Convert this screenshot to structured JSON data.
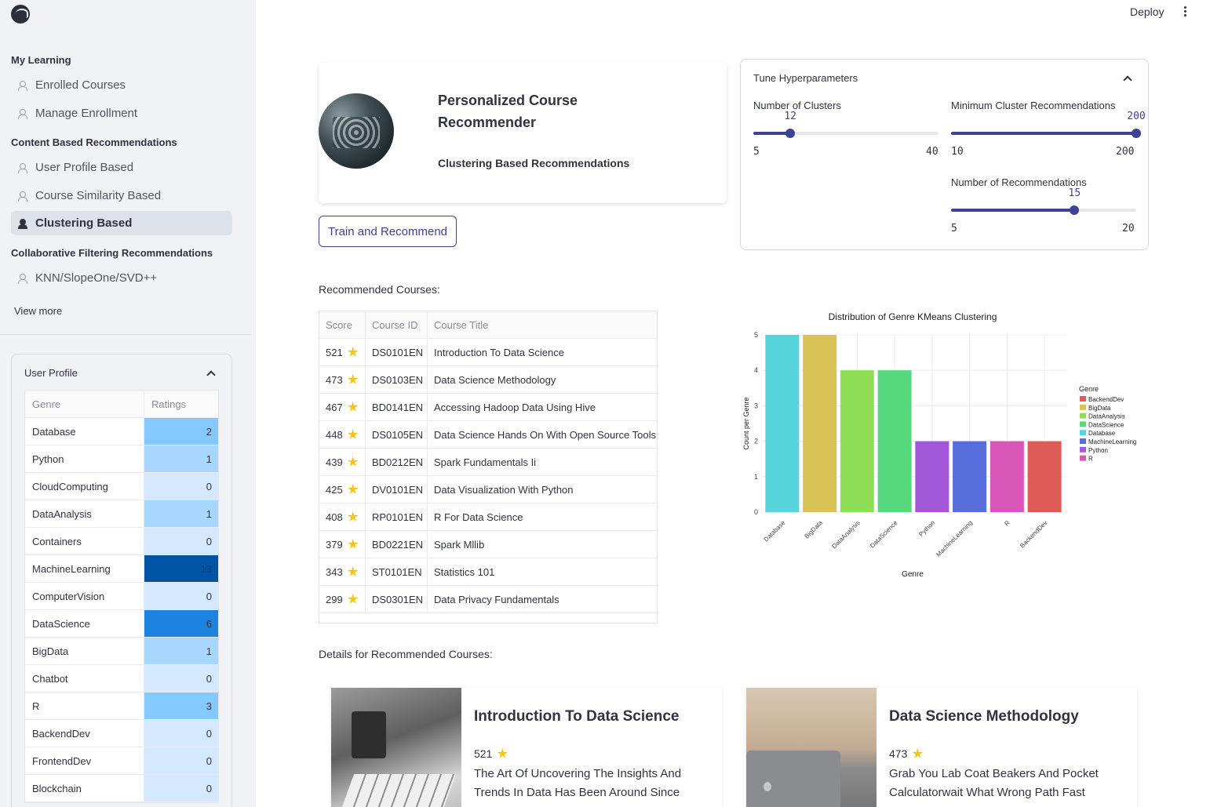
{
  "header": {
    "deploy_label": "Deploy"
  },
  "sidebar": {
    "sections": [
      {
        "label": "My Learning"
      },
      {
        "label": "Content Based Recommendations"
      },
      {
        "label": "Collaborative Filtering Recommendations"
      }
    ],
    "items": [
      {
        "label": "Enrolled Courses"
      },
      {
        "label": "Manage Enrollment"
      },
      {
        "label": "User Profile Based"
      },
      {
        "label": "Course Similarity Based"
      },
      {
        "label": "Clustering Based"
      },
      {
        "label": "KNN/SlopeOne/SVD++"
      }
    ],
    "view_more": "View more"
  },
  "user_profile": {
    "title": "User Profile",
    "columns": [
      "Genre",
      "Ratings"
    ],
    "rows": [
      {
        "genre": "Database",
        "rating": "2",
        "color": "#83c9ff"
      },
      {
        "genre": "Python",
        "rating": "1",
        "color": "#a9d6ff"
      },
      {
        "genre": "CloudComputing",
        "rating": "0",
        "color": "#d4e9ff"
      },
      {
        "genre": "DataAnalysis",
        "rating": "1",
        "color": "#a9d6ff"
      },
      {
        "genre": "Containers",
        "rating": "0",
        "color": "#d4e9ff"
      },
      {
        "genre": "MachineLearning",
        "rating": "13",
        "color": "#0054a3"
      },
      {
        "genre": "ComputerVision",
        "rating": "0",
        "color": "#d4e9ff"
      },
      {
        "genre": "DataScience",
        "rating": "6",
        "color": "#1c83e1"
      },
      {
        "genre": "BigData",
        "rating": "1",
        "color": "#a9d6ff"
      },
      {
        "genre": "Chatbot",
        "rating": "0",
        "color": "#d4e9ff"
      },
      {
        "genre": "R",
        "rating": "3",
        "color": "#83c9ff"
      },
      {
        "genre": "BackendDev",
        "rating": "0",
        "color": "#d4e9ff"
      },
      {
        "genre": "FrontendDev",
        "rating": "0",
        "color": "#d4e9ff"
      },
      {
        "genre": "Blockchain",
        "rating": "0",
        "color": "#d4e9ff"
      }
    ]
  },
  "hero": {
    "title": "Personalized Course Recommender",
    "subtitle": "Clustering Based Recommendations"
  },
  "train_button": "Train and Recommend",
  "hyperparameters": {
    "title": "Tune Hyperparameters",
    "sliders": [
      {
        "label": "Number of Clusters",
        "value": 12,
        "min": 5,
        "max": 40
      },
      {
        "label": "Minimum Cluster Recommendations",
        "value": 200,
        "min": 10,
        "max": 200
      },
      {
        "label": "Number of Recommendations",
        "value": 15,
        "min": 5,
        "max": 20
      }
    ]
  },
  "recommended": {
    "label": "Recommended Courses:",
    "columns": [
      "Score",
      "Course ID",
      "Course Title"
    ],
    "rows": [
      {
        "score": "521",
        "id": "DS0101EN",
        "title": "Introduction To Data Science"
      },
      {
        "score": "473",
        "id": "DS0103EN",
        "title": "Data Science Methodology"
      },
      {
        "score": "467",
        "id": "BD0141EN",
        "title": "Accessing Hadoop Data Using Hive"
      },
      {
        "score": "448",
        "id": "DS0105EN",
        "title": "Data Science Hands On With Open Source Tools"
      },
      {
        "score": "439",
        "id": "BD0212EN",
        "title": "Spark Fundamentals Ii"
      },
      {
        "score": "425",
        "id": "DV0101EN",
        "title": "Data Visualization With Python"
      },
      {
        "score": "408",
        "id": "RP0101EN",
        "title": "R For Data Science"
      },
      {
        "score": "379",
        "id": "BD0221EN",
        "title": "Spark Mllib"
      },
      {
        "score": "343",
        "id": "ST0101EN",
        "title": "Statistics 101"
      },
      {
        "score": "299",
        "id": "DS0301EN",
        "title": "Data Privacy Fundamentals"
      }
    ]
  },
  "chart_data": {
    "type": "bar",
    "title": "Distribution of Genre KMeans Clustering",
    "xlabel": "Genre",
    "ylabel": "Count per Genre",
    "categories": [
      "Database",
      "BigData",
      "DataAnalysis",
      "DataScience",
      "Python",
      "MachineLearning",
      "R",
      "BackendDev"
    ],
    "values": [
      5,
      5,
      4,
      4,
      2,
      2,
      2,
      2
    ],
    "colors": [
      "#56d3db",
      "#d9c356",
      "#90dd56",
      "#56d87c",
      "#a256d8",
      "#566ddb",
      "#d856b8",
      "#dd5c56"
    ],
    "ylim": [
      0,
      5
    ],
    "yticks": [
      "0",
      "1",
      "2",
      "3",
      "4",
      "5"
    ],
    "grid": true,
    "legend": {
      "title": "Genre",
      "placement": "right",
      "entries": [
        {
          "name": "BackendDev",
          "color": "#dd5c56"
        },
        {
          "name": "BigData",
          "color": "#d9c356"
        },
        {
          "name": "DataAnalysis",
          "color": "#90dd56"
        },
        {
          "name": "DataScience",
          "color": "#56d87c"
        },
        {
          "name": "Database",
          "color": "#56d3db"
        },
        {
          "name": "MachineLearning",
          "color": "#566ddb"
        },
        {
          "name": "Python",
          "color": "#a256d8"
        },
        {
          "name": "R",
          "color": "#d856b8"
        }
      ]
    }
  },
  "details": {
    "label": "Details for Recommended Courses:",
    "cards": [
      {
        "title": "Introduction To Data Science",
        "score": "521",
        "description": "The Art Of Uncovering The Insights And Trends In Data Has Been Around Since"
      },
      {
        "title": "Data Science Methodology",
        "score": "473",
        "description": "Grab You Lab Coat Beakers And Pocket Calculatorwait What Wrong Path Fast"
      }
    ]
  }
}
